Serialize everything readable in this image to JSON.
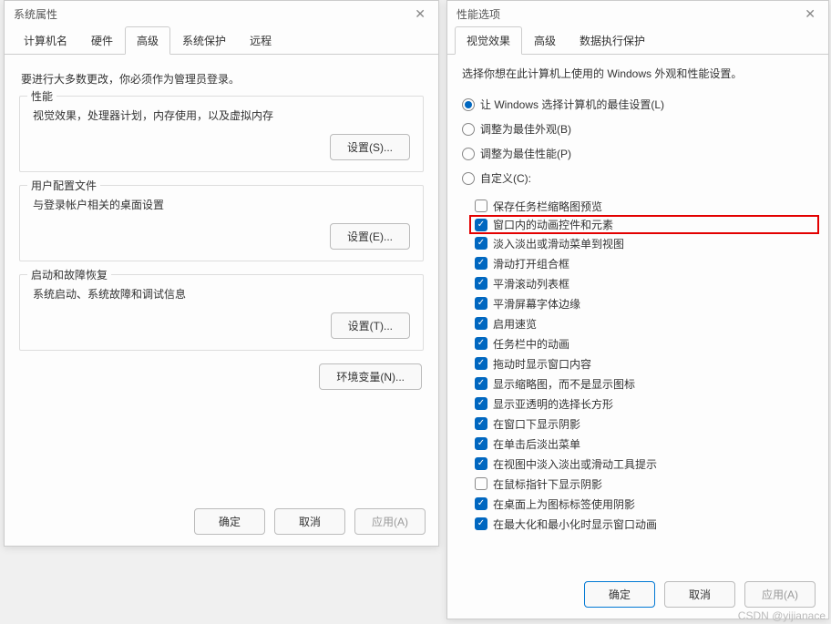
{
  "left": {
    "title": "系统属性",
    "tabs": [
      "计算机名",
      "硬件",
      "高级",
      "系统保护",
      "远程"
    ],
    "active_tab_index": 2,
    "notice": "要进行大多数更改，你必须作为管理员登录。",
    "groups": {
      "perf": {
        "title": "性能",
        "text": "视觉效果，处理器计划，内存使用，以及虚拟内存",
        "btn": "设置(S)..."
      },
      "user": {
        "title": "用户配置文件",
        "text": "与登录帐户相关的桌面设置",
        "btn": "设置(E)..."
      },
      "startup": {
        "title": "启动和故障恢复",
        "text": "系统启动、系统故障和调试信息",
        "btn": "设置(T)..."
      }
    },
    "env_btn": "环境变量(N)...",
    "ok": "确定",
    "cancel": "取消",
    "apply": "应用(A)"
  },
  "right": {
    "title": "性能选项",
    "tabs": [
      "视觉效果",
      "高级",
      "数据执行保护"
    ],
    "active_tab_index": 0,
    "description": "选择你想在此计算机上使用的 Windows 外观和性能设置。",
    "radios": [
      {
        "label": "让 Windows 选择计算机的最佳设置(L)",
        "checked": true
      },
      {
        "label": "调整为最佳外观(B)",
        "checked": false
      },
      {
        "label": "调整为最佳性能(P)",
        "checked": false
      },
      {
        "label": "自定义(C):",
        "checked": false
      }
    ],
    "checks": [
      {
        "label": "保存任务栏缩略图预览",
        "checked": false,
        "highlight": false
      },
      {
        "label": "窗口内的动画控件和元素",
        "checked": true,
        "highlight": true
      },
      {
        "label": "淡入淡出或滑动菜单到视图",
        "checked": true,
        "highlight": false
      },
      {
        "label": "滑动打开组合框",
        "checked": true,
        "highlight": false
      },
      {
        "label": "平滑滚动列表框",
        "checked": true,
        "highlight": false
      },
      {
        "label": "平滑屏幕字体边缘",
        "checked": true,
        "highlight": false
      },
      {
        "label": "启用速览",
        "checked": true,
        "highlight": false
      },
      {
        "label": "任务栏中的动画",
        "checked": true,
        "highlight": false
      },
      {
        "label": "拖动时显示窗口内容",
        "checked": true,
        "highlight": false
      },
      {
        "label": "显示缩略图，而不是显示图标",
        "checked": true,
        "highlight": false
      },
      {
        "label": "显示亚透明的选择长方形",
        "checked": true,
        "highlight": false
      },
      {
        "label": "在窗口下显示阴影",
        "checked": true,
        "highlight": false
      },
      {
        "label": "在单击后淡出菜单",
        "checked": true,
        "highlight": false
      },
      {
        "label": "在视图中淡入淡出或滑动工具提示",
        "checked": true,
        "highlight": false
      },
      {
        "label": "在鼠标指针下显示阴影",
        "checked": false,
        "highlight": false
      },
      {
        "label": "在桌面上为图标标签使用阴影",
        "checked": true,
        "highlight": false
      },
      {
        "label": "在最大化和最小化时显示窗口动画",
        "checked": true,
        "highlight": false
      }
    ],
    "ok": "确定",
    "cancel": "取消",
    "apply": "应用(A)"
  },
  "watermark": "CSDN @yijianace"
}
